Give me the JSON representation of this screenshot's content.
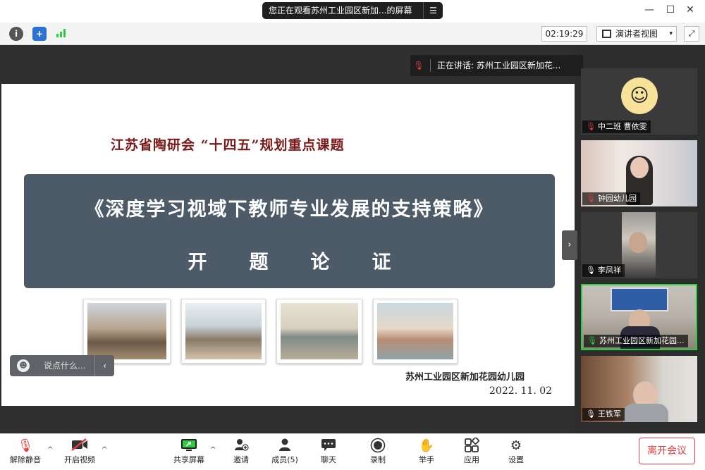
{
  "titlebar": {
    "share_text": "您正在观看苏州工业园区新加...的屏幕",
    "menu_icon": "list-icon",
    "min": "—",
    "max": "☐",
    "close": "✕"
  },
  "toolbar": {
    "timer": "02:19:29",
    "view_label": "演讲者视图",
    "view_caret": "▾",
    "fullscreen": "⤢"
  },
  "speaker_bar": {
    "text": "正在讲话: 苏州工业园区新加花..."
  },
  "slide": {
    "org_title": "江苏省陶研会 “十四五”规划重点课题",
    "main_title": "《深度学习视域下教师专业发展的支持策略》",
    "subtitle": "开题论证",
    "school": "苏州工业园区新加花园幼儿园",
    "date": "2022. 11. 02"
  },
  "chat": {
    "placeholder": "说点什么...",
    "chevron": "‹"
  },
  "side_toggle": "›",
  "participants": [
    {
      "name": "中二班 曹依雯",
      "mic": "muted",
      "avatar": "cartoon-avatar"
    },
    {
      "name": "钟园幼儿园",
      "mic": "muted",
      "avatar": "video-feed"
    },
    {
      "name": "李凤祥",
      "mic": "on",
      "avatar": "video-feed"
    },
    {
      "name": "苏州工业园区新加花园...",
      "mic": "speaking",
      "avatar": "video-feed"
    },
    {
      "name": "王铁军",
      "mic": "on",
      "avatar": "video-feed"
    }
  ],
  "bottom": {
    "unmute": "解除静音",
    "start_video": "开启视频",
    "share": "共享屏幕",
    "invite": "邀请",
    "members": "成员(5)",
    "chat": "聊天",
    "record": "录制",
    "raise_hand": "举手",
    "apps": "应用",
    "settings": "设置",
    "leave": "离开会议",
    "caret": "^"
  },
  "colors": {
    "accent_red": "#e04040",
    "active_green": "#2ecc40",
    "banner_bg": "#4d5b69",
    "org_title_color": "#7b1a1a"
  }
}
